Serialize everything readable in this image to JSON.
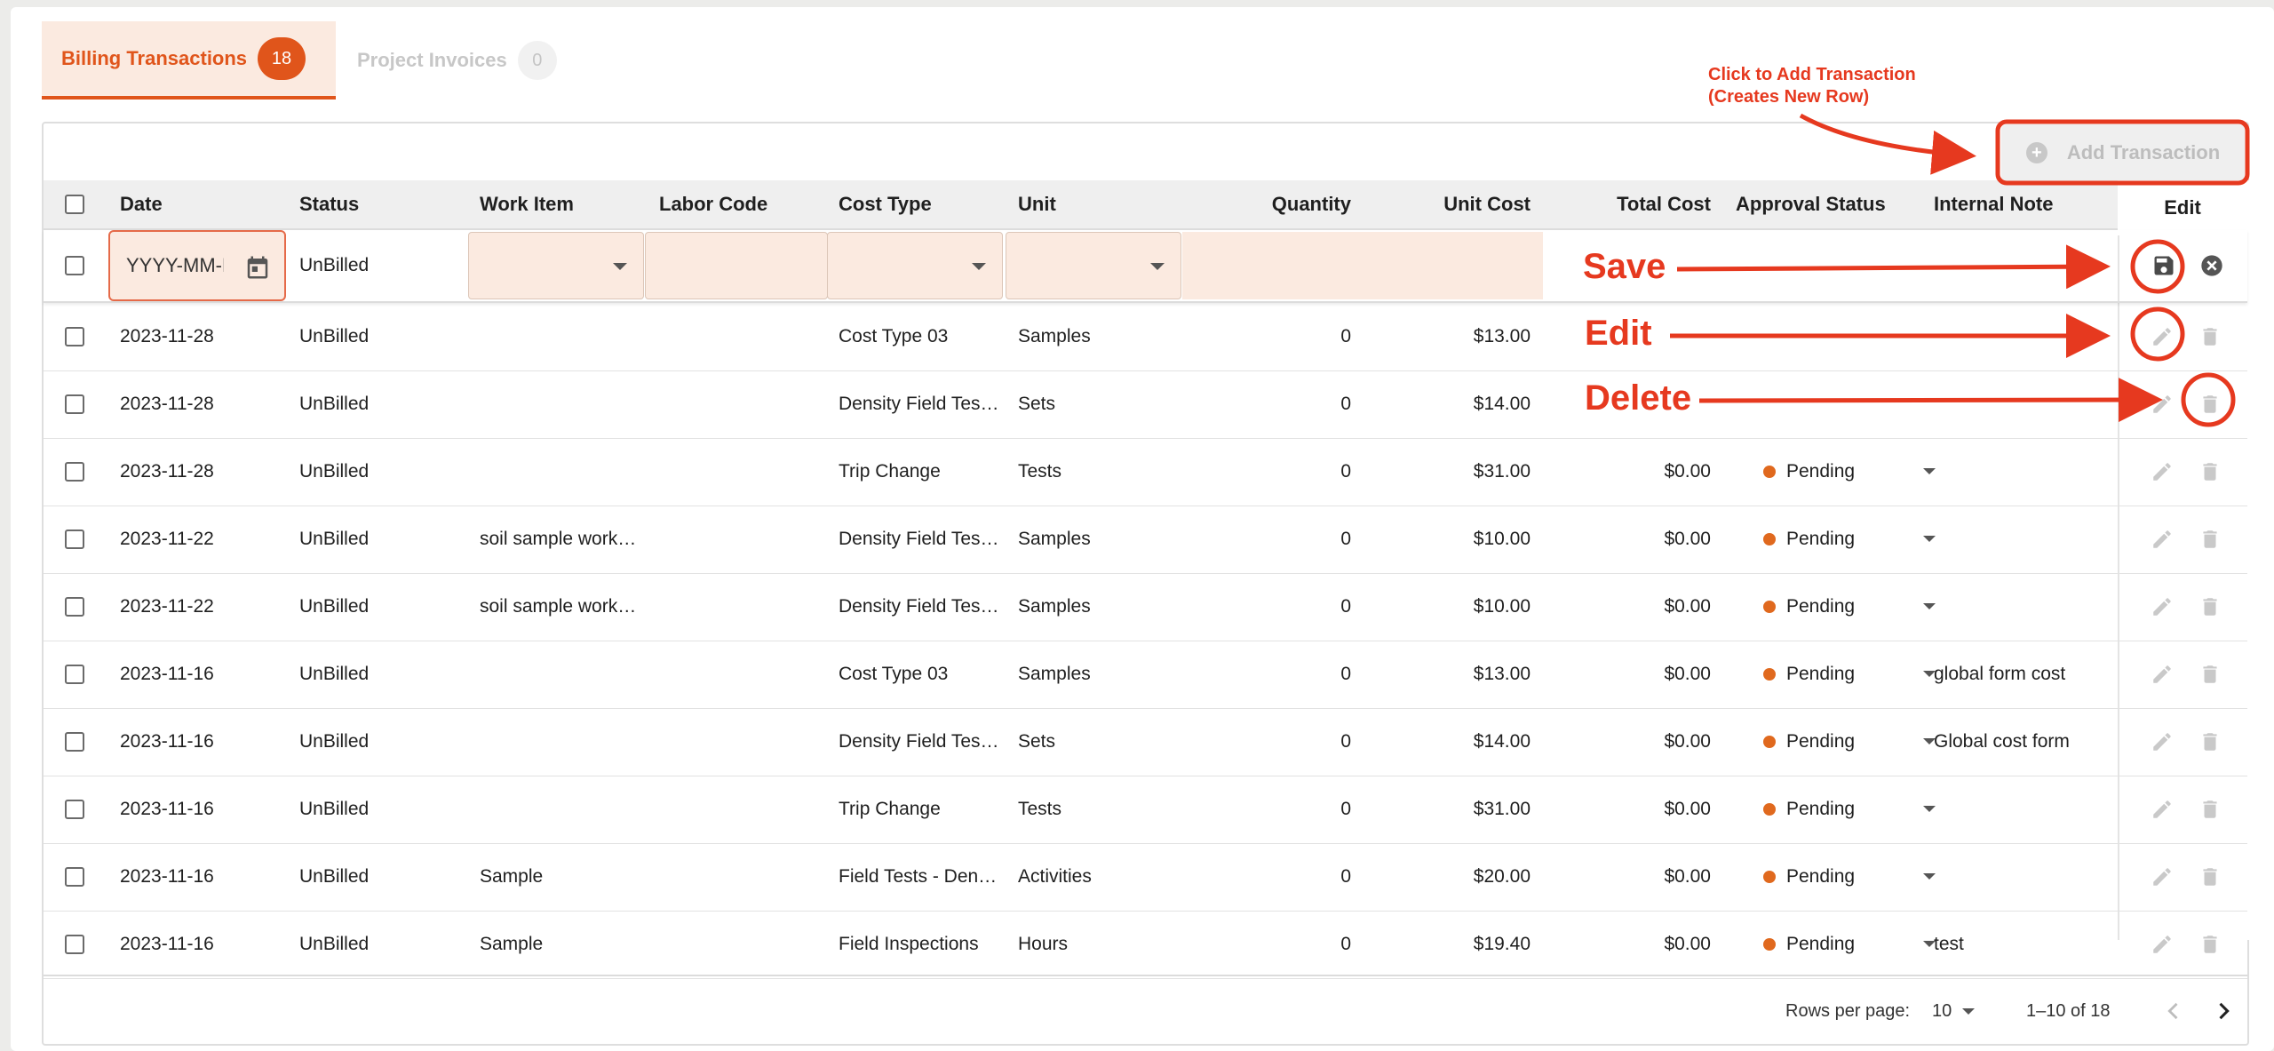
{
  "tabs": [
    {
      "label": "Billing Transactions",
      "count": "18"
    },
    {
      "label": "Project Invoices",
      "count": "0"
    }
  ],
  "toolbar": {
    "add_label": "Add Transaction"
  },
  "columns": {
    "date": "Date",
    "status": "Status",
    "work_item": "Work Item",
    "labor_code": "Labor Code",
    "cost_type": "Cost Type",
    "unit": "Unit",
    "quantity": "Quantity",
    "unit_cost": "Unit Cost",
    "total_cost": "Total Cost",
    "approval_status": "Approval Status",
    "internal_note": "Internal Note",
    "edit": "Edit"
  },
  "new_row": {
    "date_placeholder": "YYYY-MM-DD",
    "status": "UnBilled"
  },
  "rows": [
    {
      "date": "2023-11-28",
      "status": "UnBilled",
      "work_item": "",
      "labor_code": "",
      "cost_type": "Cost Type 03",
      "unit": "Samples",
      "quantity": "0",
      "unit_cost": "$13.00",
      "total_cost": "",
      "approval": "",
      "note": ""
    },
    {
      "date": "2023-11-28",
      "status": "UnBilled",
      "work_item": "",
      "labor_code": "",
      "cost_type": "Density Field Tes…",
      "unit": "Sets",
      "quantity": "0",
      "unit_cost": "$14.00",
      "total_cost": "",
      "approval": "",
      "note": ""
    },
    {
      "date": "2023-11-28",
      "status": "UnBilled",
      "work_item": "",
      "labor_code": "",
      "cost_type": "Trip Change",
      "unit": "Tests",
      "quantity": "0",
      "unit_cost": "$31.00",
      "total_cost": "$0.00",
      "approval": "Pending",
      "note": ""
    },
    {
      "date": "2023-11-22",
      "status": "UnBilled",
      "work_item": "soil sample work…",
      "labor_code": "",
      "cost_type": "Density Field Tes…",
      "unit": "Samples",
      "quantity": "0",
      "unit_cost": "$10.00",
      "total_cost": "$0.00",
      "approval": "Pending",
      "note": ""
    },
    {
      "date": "2023-11-22",
      "status": "UnBilled",
      "work_item": "soil sample work…",
      "labor_code": "",
      "cost_type": "Density Field Tes…",
      "unit": "Samples",
      "quantity": "0",
      "unit_cost": "$10.00",
      "total_cost": "$0.00",
      "approval": "Pending",
      "note": ""
    },
    {
      "date": "2023-11-16",
      "status": "UnBilled",
      "work_item": "",
      "labor_code": "",
      "cost_type": "Cost Type 03",
      "unit": "Samples",
      "quantity": "0",
      "unit_cost": "$13.00",
      "total_cost": "$0.00",
      "approval": "Pending",
      "note": "global form cost"
    },
    {
      "date": "2023-11-16",
      "status": "UnBilled",
      "work_item": "",
      "labor_code": "",
      "cost_type": "Density Field Tes…",
      "unit": "Sets",
      "quantity": "0",
      "unit_cost": "$14.00",
      "total_cost": "$0.00",
      "approval": "Pending",
      "note": "Global cost form"
    },
    {
      "date": "2023-11-16",
      "status": "UnBilled",
      "work_item": "",
      "labor_code": "",
      "cost_type": "Trip Change",
      "unit": "Tests",
      "quantity": "0",
      "unit_cost": "$31.00",
      "total_cost": "$0.00",
      "approval": "Pending",
      "note": ""
    },
    {
      "date": "2023-11-16",
      "status": "UnBilled",
      "work_item": "Sample",
      "labor_code": "",
      "cost_type": "Field Tests - Den…",
      "unit": "Activities",
      "quantity": "0",
      "unit_cost": "$20.00",
      "total_cost": "$0.00",
      "approval": "Pending",
      "note": ""
    },
    {
      "date": "2023-11-16",
      "status": "UnBilled",
      "work_item": "Sample",
      "labor_code": "",
      "cost_type": "Field Inspections",
      "unit": "Hours",
      "quantity": "0",
      "unit_cost": "$19.40",
      "total_cost": "$0.00",
      "approval": "Pending",
      "note": "test"
    }
  ],
  "footer": {
    "rows_per_page_label": "Rows per page:",
    "rows_per_page": "10",
    "range": "1–10 of 18"
  },
  "annotations": {
    "add_hint_line1": "Click to Add Transaction",
    "add_hint_line2": "(Creates New Row)",
    "save": "Save",
    "edit": "Edit",
    "delete": "Delete"
  },
  "icons": {
    "add": "plus-circle-icon",
    "calendar": "calendar-icon",
    "save": "floppy-disk-icon",
    "cancel": "close-circle-icon",
    "edit": "pencil-icon",
    "delete": "trash-icon",
    "dropdown": "caret-down-icon",
    "prev": "chevron-left-icon",
    "next": "chevron-right-icon"
  },
  "colors": {
    "accent": "#e0551b",
    "annotation": "#e6391f",
    "pending_dot": "#e0691e",
    "new_row_bg": "#fbeae0"
  }
}
